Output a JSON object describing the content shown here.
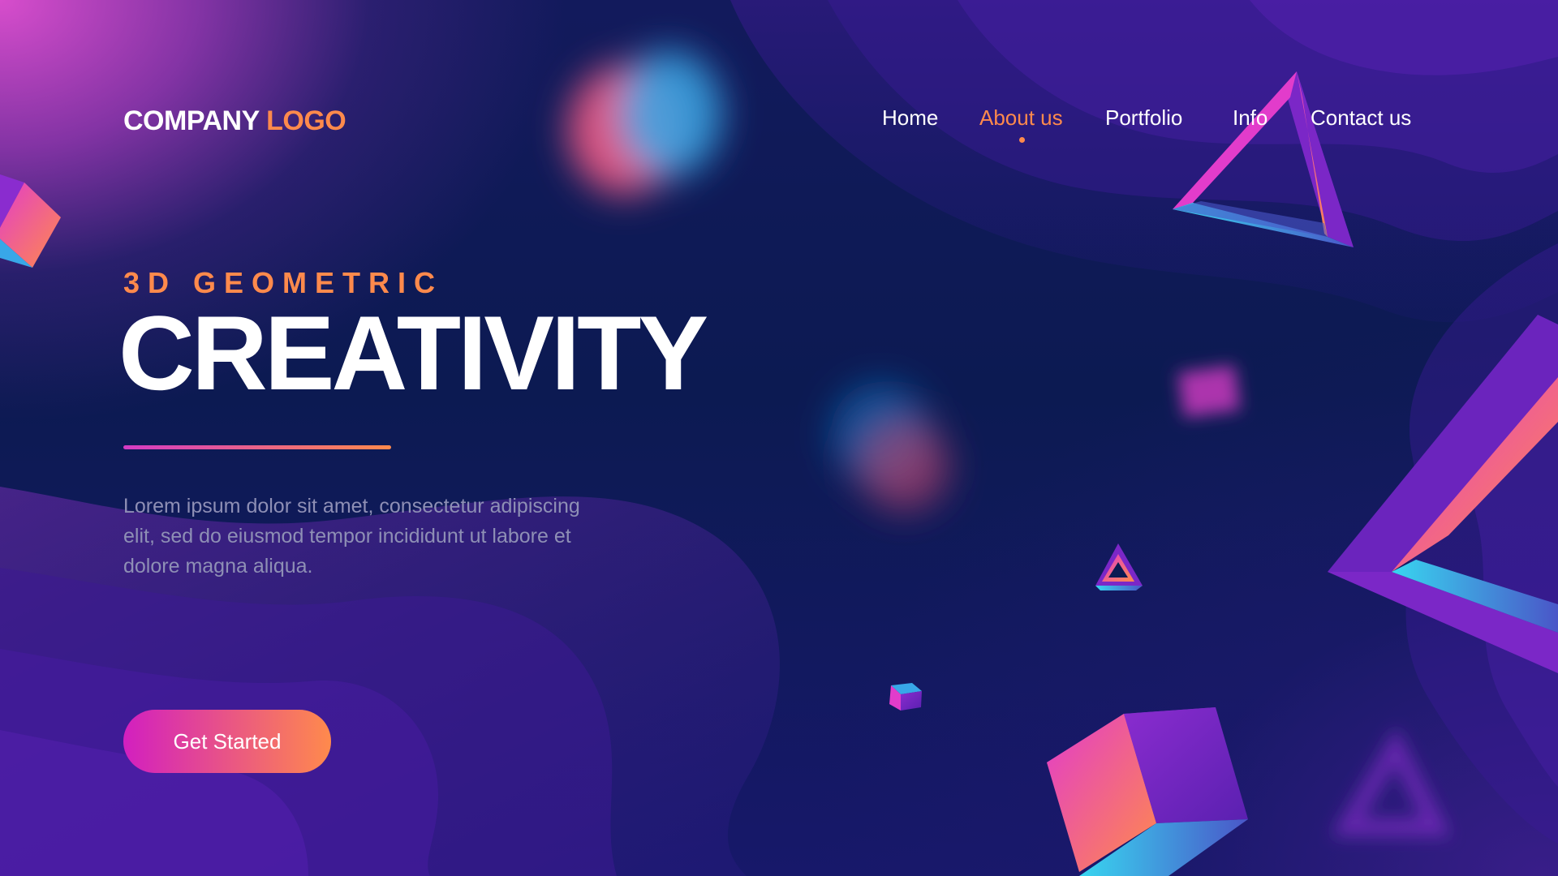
{
  "header": {
    "logo_main": "COMPANY",
    "logo_accent": "LOGO"
  },
  "nav": {
    "items": [
      {
        "label": "Home",
        "active": false
      },
      {
        "label": "About us",
        "active": true
      },
      {
        "label": "Portfolio",
        "active": false
      },
      {
        "label": "Info",
        "active": false
      },
      {
        "label": "Contact us",
        "active": false
      }
    ]
  },
  "hero": {
    "eyebrow": "3D GEOMETRIC",
    "headline": "CREATIVITY",
    "lead": "Lorem ipsum dolor sit amet, consectetur adipiscing elit, sed do eiusmod tempor incididunt ut labore et dolore magna aliqua.",
    "cta_label": "Get Started"
  },
  "colors": {
    "accent": "#ff8a4c",
    "magenta": "#d21fc0",
    "background": "#0c1a52",
    "body_text": "#8e8fb5"
  }
}
